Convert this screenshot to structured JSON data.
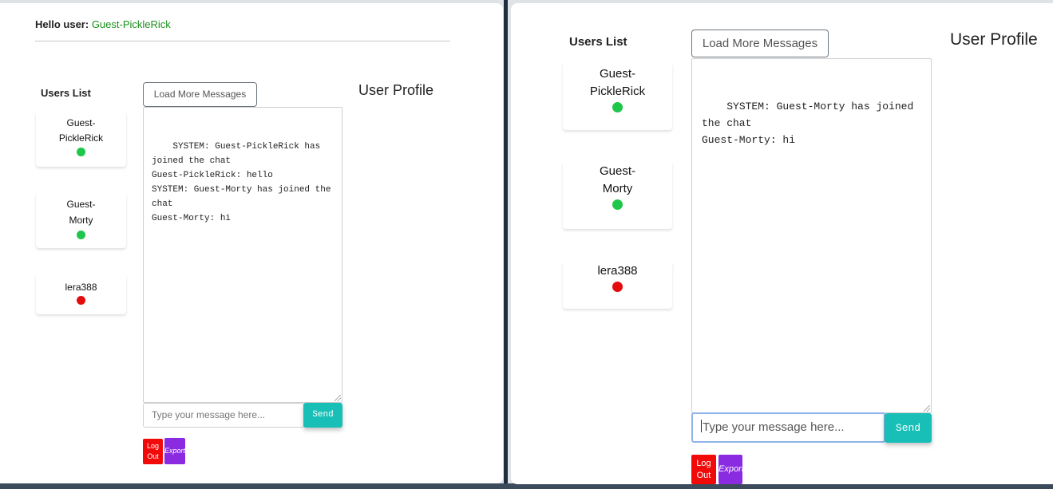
{
  "left": {
    "greeting_label": "Hello user:",
    "greeting_username": "Guest-PickleRick",
    "users_title": "Users List",
    "users": [
      {
        "name": "Guest-PickleRick",
        "status": "online"
      },
      {
        "name": "Guest-Morty",
        "status": "online"
      },
      {
        "name": "lera388",
        "status": "offline"
      }
    ],
    "load_more": "Load More Messages",
    "profile_title": "User Profile",
    "chat_text": "SYSTEM: Guest-PickleRick has joined the chat\nGuest-PickleRick: hello\nSYSTEM: Guest-Morty has joined the chat\nGuest-Morty: hi",
    "input_placeholder": "Type your message here...",
    "send_label": "Send",
    "logout_label": "Log Out",
    "export_label": "Export"
  },
  "right": {
    "users_title": "Users List",
    "users": [
      {
        "name": "Guest-PickleRick",
        "status": "online"
      },
      {
        "name": "Guest-Morty",
        "status": "online"
      },
      {
        "name": "lera388",
        "status": "offline"
      }
    ],
    "load_more": "Load More Messages",
    "profile_title": "User Profile",
    "chat_text": "SYSTEM: Guest-Morty has joined the chat\nGuest-Morty: hi",
    "input_placeholder": "Type your message here...",
    "send_label": "Send",
    "logout_label": "Log Out",
    "export_label": "Export"
  },
  "colors": {
    "online": "#1ec74b",
    "offline": "#e40c0c",
    "send": "#17bfb6",
    "logout": "#f20a0a",
    "export": "#8a2be2",
    "username": "#1a8f1a"
  }
}
